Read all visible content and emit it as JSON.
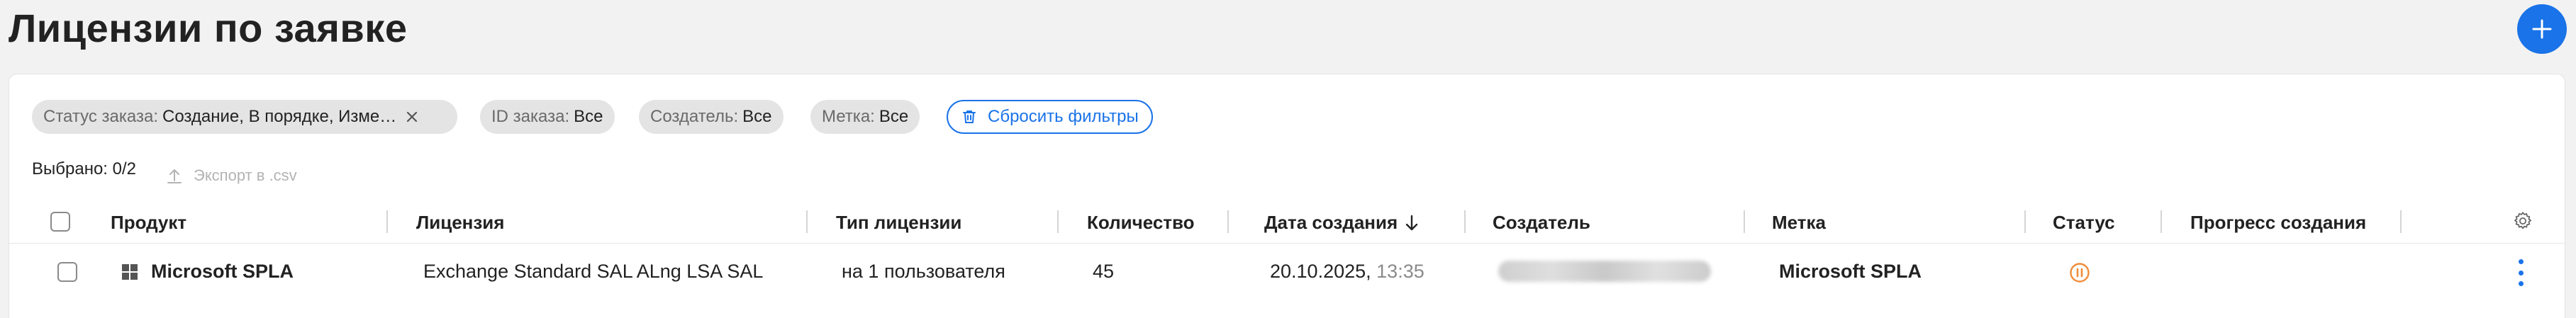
{
  "page": {
    "title": "Лицензии по заявке"
  },
  "filters": {
    "chips": [
      {
        "key": "Статус заказа:",
        "value": "Создание, В порядке, Изме…",
        "removable": true
      },
      {
        "key": "ID заказа:",
        "value": "Все"
      },
      {
        "key": "Создатель:",
        "value": "Все"
      },
      {
        "key": "Метка:",
        "value": "Все"
      }
    ],
    "reset_label": "Сбросить фильтры"
  },
  "selection": {
    "label": "Выбрано: 0/2"
  },
  "export": {
    "label": "Экспорт в .csv"
  },
  "table": {
    "columns": [
      "Продукт",
      "Лицензия",
      "Тип лицензии",
      "Количество",
      "Дата создания",
      "Создатель",
      "Метка",
      "Статус",
      "Прогресс создания"
    ],
    "sort": {
      "column": "Дата создания",
      "direction": "desc"
    },
    "rows": [
      {
        "product": "Microsoft SPLA",
        "license": "Exchange Standard SAL ALng LSA SAL",
        "license_type": "на 1 пользователя",
        "quantity": "45",
        "created_date": "20.10.2025,",
        "created_time": "13:35",
        "creator_redacted": true,
        "tag": "Microsoft SPLA",
        "status_icon": "pause-circle-icon"
      }
    ]
  },
  "colors": {
    "accent": "#1a73e8",
    "status_paused": "#f08c3a",
    "chip_bg": "#e4e4e4",
    "page_bg": "#f2f2f2"
  },
  "icons": {
    "add": "plus-icon",
    "chip_remove": "close-icon",
    "reset": "trash-icon",
    "export": "upload-icon",
    "sort": "arrow-down-icon",
    "settings": "gear-icon",
    "product": "windows-logo-icon",
    "row_menu": "more-vertical-icon"
  }
}
